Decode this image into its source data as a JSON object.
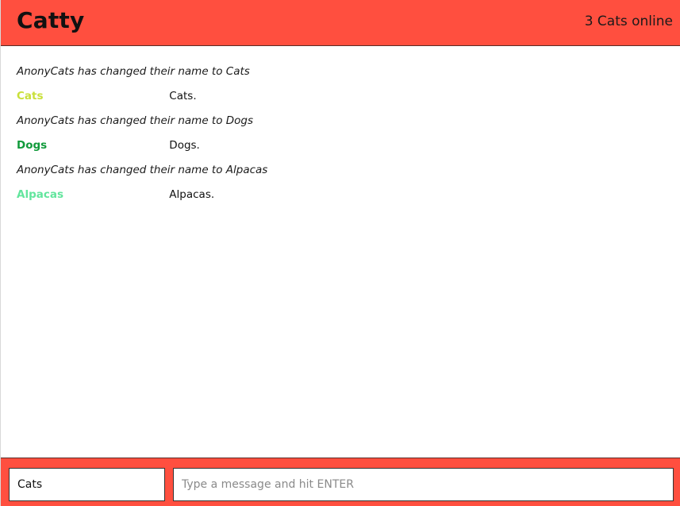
{
  "header": {
    "title": "Catty",
    "online_status": "3 Cats online"
  },
  "messages": [
    {
      "type": "system",
      "text": "AnonyCats has changed their name to Cats"
    },
    {
      "type": "chat",
      "user": "Cats",
      "user_color": "#c9e03a",
      "text": "Cats."
    },
    {
      "type": "system",
      "text": "AnonyCats has changed their name to Dogs"
    },
    {
      "type": "chat",
      "user": "Dogs",
      "user_color": "#119a3b",
      "text": "Dogs."
    },
    {
      "type": "system",
      "text": "AnonyCats has changed their name to Alpacas"
    },
    {
      "type": "chat",
      "user": "Alpacas",
      "user_color": "#62e59d",
      "text": "Alpacas."
    }
  ],
  "footer": {
    "name_value": "Cats",
    "message_placeholder": "Type a message and hit ENTER",
    "message_value": ""
  },
  "colors": {
    "accent": "#ff4f3f"
  }
}
